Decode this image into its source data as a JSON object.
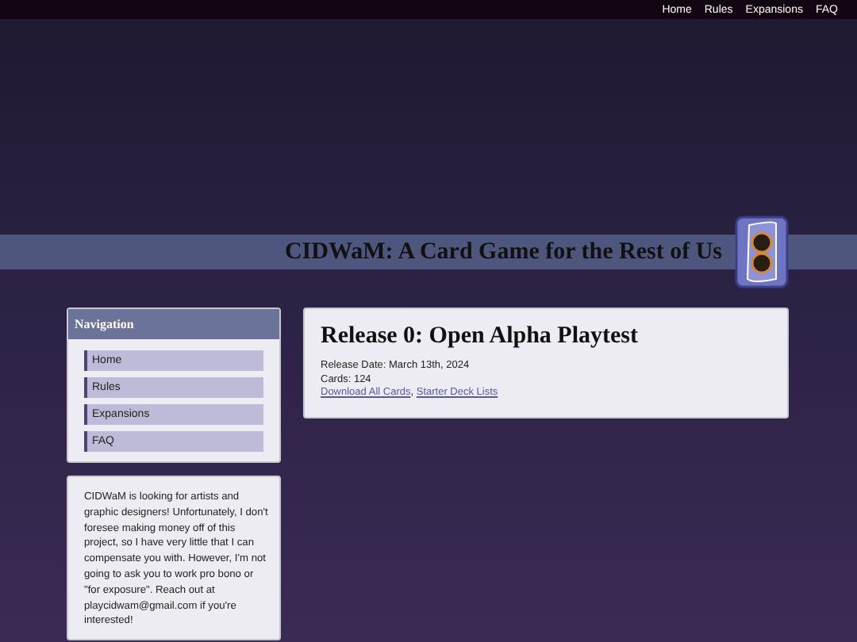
{
  "top_nav": [
    {
      "label": "Home"
    },
    {
      "label": "Rules"
    },
    {
      "label": "Expansions"
    },
    {
      "label": "FAQ"
    }
  ],
  "banner": {
    "title": "CIDWaM: A Card Game for the Rest of Us"
  },
  "sidebar": {
    "navigation": {
      "title": "Navigation",
      "items": [
        {
          "label": "Home"
        },
        {
          "label": "Rules"
        },
        {
          "label": "Expansions"
        },
        {
          "label": "FAQ"
        }
      ]
    },
    "notice": "CIDWaM is looking for artists and graphic designers! Unfortunately, I don't foresee making money off of this project, so I have very little that I can compensate you with. However, I'm not going to ask you to work pro bono or \"for exposure\". Reach out at playcidwam@gmail.com if you're interested!"
  },
  "release": {
    "title": "Release 0: Open Alpha Playtest",
    "details": [
      "Release Date: March 13th, 2024",
      "Cards: 124"
    ],
    "links": [
      {
        "label": "Download All Cards"
      },
      {
        "label": "Starter Deck Lists"
      }
    ],
    "link_separator": ", "
  }
}
